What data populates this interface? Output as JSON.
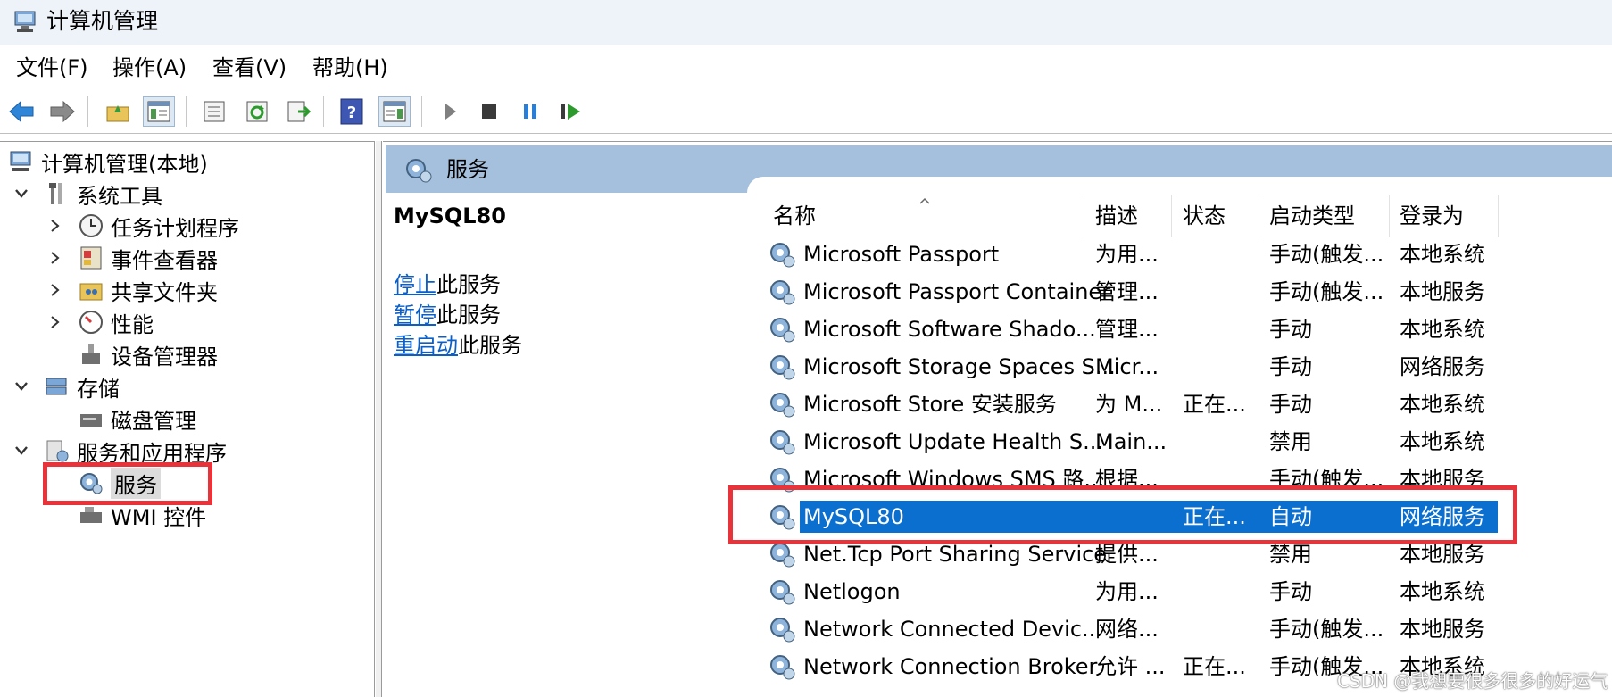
{
  "window": {
    "title": "计算机管理",
    "icon": "computer-management-icon"
  },
  "menu": [
    "文件(F)",
    "操作(A)",
    "查看(V)",
    "帮助(H)"
  ],
  "toolbar": {
    "buttons": [
      "back-icon",
      "forward-icon",
      "up-folder-icon",
      "show-hide-tree-icon",
      "properties-icon",
      "refresh-icon",
      "export-list-icon",
      "help-icon",
      "show-action-pane-icon",
      "start-service-icon",
      "stop-service-icon",
      "pause-service-icon",
      "restart-service-icon"
    ]
  },
  "tree": {
    "root": "计算机管理(本地)",
    "system_tools": "系统工具",
    "task_scheduler": "任务计划程序",
    "event_viewer": "事件查看器",
    "shared_folders": "共享文件夹",
    "performance": "性能",
    "device_manager": "设备管理器",
    "storage": "存储",
    "disk_management": "磁盘管理",
    "services_apps": "服务和应用程序",
    "services": "服务",
    "wmi": "WMI 控件"
  },
  "services_panel": {
    "header": "服务",
    "selected_service": "MySQL80",
    "actions": [
      {
        "link": "停止",
        "suffix": "此服务"
      },
      {
        "link": "暂停",
        "suffix": "此服务"
      },
      {
        "link": "重启动",
        "suffix": "此服务"
      }
    ],
    "columns": [
      "名称",
      "描述",
      "状态",
      "启动类型",
      "登录为"
    ],
    "rows": [
      {
        "name": "Microsoft Passport",
        "desc": "为用...",
        "status": "",
        "startup": "手动(触发...",
        "logon": "本地系统"
      },
      {
        "name": "Microsoft Passport Container",
        "desc": "管理...",
        "status": "",
        "startup": "手动(触发...",
        "logon": "本地服务"
      },
      {
        "name": "Microsoft Software Shado...",
        "desc": "管理...",
        "status": "",
        "startup": "手动",
        "logon": "本地系统"
      },
      {
        "name": "Microsoft Storage Spaces S...",
        "desc": "Micr...",
        "status": "",
        "startup": "手动",
        "logon": "网络服务"
      },
      {
        "name": "Microsoft Store 安装服务",
        "desc": "为 M...",
        "status": "正在...",
        "startup": "手动",
        "logon": "本地系统"
      },
      {
        "name": "Microsoft Update Health S...",
        "desc": "Main...",
        "status": "",
        "startup": "禁用",
        "logon": "本地系统"
      },
      {
        "name": "Microsoft Windows SMS 路...",
        "desc": "根据...",
        "status": "",
        "startup": "手动(触发...",
        "logon": "本地服务"
      },
      {
        "name": "MySQL80",
        "desc": "",
        "status": "正在...",
        "startup": "自动",
        "logon": "网络服务"
      },
      {
        "name": "Net.Tcp Port Sharing Service",
        "desc": "提供...",
        "status": "",
        "startup": "禁用",
        "logon": "本地服务"
      },
      {
        "name": "Netlogon",
        "desc": "为用...",
        "status": "",
        "startup": "手动",
        "logon": "本地系统"
      },
      {
        "name": "Network Connected Devic...",
        "desc": "网络...",
        "status": "",
        "startup": "手动(触发...",
        "logon": "本地服务"
      },
      {
        "name": "Network Connection Broker",
        "desc": "允许 ...",
        "status": "正在...",
        "startup": "手动(触发...",
        "logon": "本地系统"
      }
    ]
  },
  "watermark": "CSDN @我想要很多很多的好运气",
  "colors": {
    "highlight": "#0b6fd0",
    "annotation": "#e8333a",
    "header_band": "#a5c0dc",
    "link": "#0b5fc7"
  }
}
